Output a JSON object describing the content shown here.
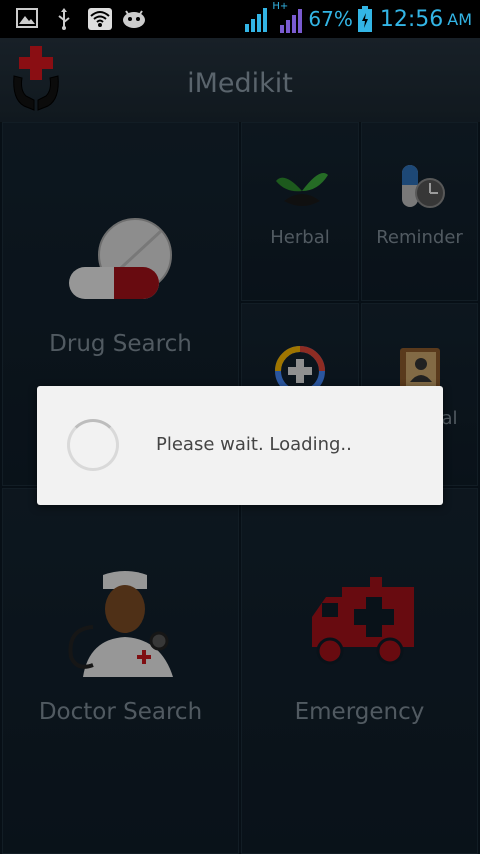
{
  "status_bar": {
    "icons": [
      "image-icon",
      "usb-icon",
      "wifi-icon",
      "android-debug-icon",
      "signal-icon",
      "hplus-signal-icon",
      "battery-icon"
    ],
    "network_label": "H+",
    "battery": "67%",
    "time": "12:56",
    "ampm": "AM"
  },
  "header": {
    "title": "iMedikit"
  },
  "tiles": {
    "drug_search": "Drug Search",
    "herbal": "Herbal",
    "reminder": "Reminder",
    "doctor_search": "Doctor Search",
    "emergency": "Emergency",
    "partial_label": "al"
  },
  "dialog": {
    "message": "Please wait. Loading.."
  },
  "colors": {
    "accent": "#33b5e5",
    "background": "#0b1822",
    "medical_red": "#c4161c"
  }
}
